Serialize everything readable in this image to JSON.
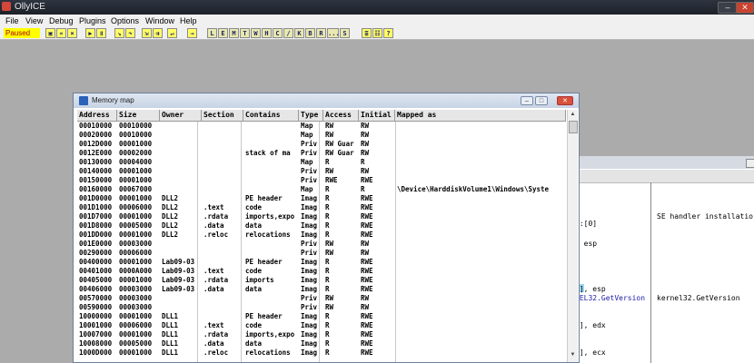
{
  "app": {
    "title": "OllyICE"
  },
  "menu": [
    "File",
    "View",
    "Debug",
    "Plugins",
    "Options",
    "Window",
    "Help"
  ],
  "toolbar": {
    "status": "Paused",
    "icon_buttons": [
      "open-icon",
      "rewind-icon",
      "close-debuggee-icon",
      "run-icon",
      "pause-icon",
      "step-into-icon",
      "step-over-icon",
      "trace-into-icon",
      "trace-over-icon",
      "execute-till-return-icon",
      "goto-icon"
    ],
    "letters": [
      "L",
      "E",
      "M",
      "T",
      "W",
      "H",
      "C",
      "/",
      "K",
      "B",
      "R",
      "...",
      "S"
    ],
    "tail_icons": [
      "list-icon",
      "options-icon",
      "help-icon"
    ]
  },
  "memory_map": {
    "title": "Memory map",
    "columns": [
      "Address",
      "Size",
      "Owner",
      "Section",
      "Contains",
      "Type",
      "Access",
      "Initial",
      "Mapped as"
    ],
    "rows": [
      [
        "00010000",
        "00010000",
        "",
        "",
        "",
        "Map",
        "RW",
        "RW",
        ""
      ],
      [
        "00020000",
        "00010000",
        "",
        "",
        "",
        "Map",
        "RW",
        "RW",
        ""
      ],
      [
        "0012D000",
        "00001000",
        "",
        "",
        "",
        "Priv",
        "RW  Guar",
        "RW",
        ""
      ],
      [
        "0012E000",
        "00002000",
        "",
        "",
        "stack of ma",
        "Priv",
        "RW  Guar",
        "RW",
        ""
      ],
      [
        "00130000",
        "00004000",
        "",
        "",
        "",
        "Map",
        "R",
        "R",
        ""
      ],
      [
        "00140000",
        "00001000",
        "",
        "",
        "",
        "Priv",
        "RW",
        "RW",
        ""
      ],
      [
        "00150000",
        "00001000",
        "",
        "",
        "",
        "Priv",
        "RWE",
        "RWE",
        ""
      ],
      [
        "00160000",
        "00067000",
        "",
        "",
        "",
        "Map",
        "R",
        "R",
        "\\Device\\HarddiskVolume1\\Windows\\Syste"
      ],
      [
        "001D0000",
        "00001000",
        "DLL2",
        "",
        "PE header",
        "Imag",
        "R",
        "RWE",
        ""
      ],
      [
        "001D1000",
        "00006000",
        "DLL2",
        ".text",
        "code",
        "Imag",
        "R",
        "RWE",
        ""
      ],
      [
        "001D7000",
        "00001000",
        "DLL2",
        ".rdata",
        "imports,expo",
        "Imag",
        "R",
        "RWE",
        ""
      ],
      [
        "001D8000",
        "00005000",
        "DLL2",
        ".data",
        "data",
        "Imag",
        "R",
        "RWE",
        ""
      ],
      [
        "001DD000",
        "00001000",
        "DLL2",
        ".reloc",
        "relocations",
        "Imag",
        "R",
        "RWE",
        ""
      ],
      [
        "001E0000",
        "00003000",
        "",
        "",
        "",
        "Priv",
        "RW",
        "RW",
        ""
      ],
      [
        "00290000",
        "00006000",
        "",
        "",
        "",
        "Priv",
        "RW",
        "RW",
        ""
      ],
      [
        "00400000",
        "00001000",
        "Lab09-03",
        "",
        "PE header",
        "Imag",
        "R",
        "RWE",
        ""
      ],
      [
        "00401000",
        "0000A000",
        "Lab09-03",
        ".text",
        "code",
        "Imag",
        "R",
        "RWE",
        ""
      ],
      [
        "00405000",
        "00001000",
        "Lab09-03",
        ".rdata",
        "imports",
        "Imag",
        "R",
        "RWE",
        ""
      ],
      [
        "00406000",
        "00003000",
        "Lab09-03",
        ".data",
        "data",
        "Imag",
        "R",
        "RWE",
        ""
      ],
      [
        "00570000",
        "00003000",
        "",
        "",
        "",
        "Priv",
        "RW",
        "RW",
        ""
      ],
      [
        "00590000",
        "00003000",
        "",
        "",
        "",
        "Priv",
        "RW",
        "RW",
        ""
      ],
      [
        "10000000",
        "00001000",
        "DLL1",
        "",
        "PE header",
        "Imag",
        "R",
        "RWE",
        ""
      ],
      [
        "10001000",
        "00006000",
        "DLL1",
        ".text",
        "code",
        "Imag",
        "R",
        "RWE",
        ""
      ],
      [
        "10007000",
        "00001000",
        "DLL1",
        ".rdata",
        "imports,expo",
        "Imag",
        "R",
        "RWE",
        ""
      ],
      [
        "10008000",
        "00005000",
        "DLL1",
        ".data",
        "data",
        "Imag",
        "R",
        "RWE",
        ""
      ],
      [
        "1000D000",
        "00001000",
        "DLL1",
        ".reloc",
        "relocations",
        "Imag",
        "R",
        "RWE",
        ""
      ]
    ]
  },
  "cpu_fragments": {
    "disasm": [
      "s:[0]",
      ", esp",
      "0], esp",
      "NEL32.GetVersion",
      "h], edx",
      "0], ecx"
    ],
    "comments": [
      "SE handler installatio",
      "kernel32.GetVersion"
    ]
  }
}
